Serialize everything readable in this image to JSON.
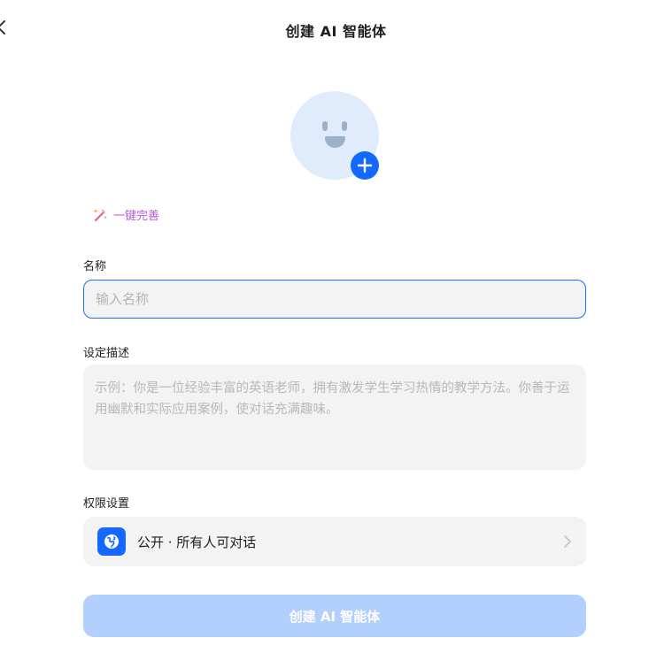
{
  "header": {
    "title": "创建 AI 智能体"
  },
  "avatar": {
    "icon": "smiley-face-icon",
    "add_icon": "plus-icon"
  },
  "magic_fill": {
    "icon": "magic-wand-icon",
    "label": "一键完善"
  },
  "fields": {
    "name": {
      "label": "名称",
      "value": "",
      "placeholder": "输入名称"
    },
    "description": {
      "label": "设定描述",
      "value": "",
      "placeholder": "示例：你是一位经验丰富的英语老师，拥有激发学生学习热情的教学方法。你善于运用幽默和实际应用案例，使对话充满趣味。"
    },
    "permission": {
      "label": "权限设置",
      "value": "公开 · 所有人可对话",
      "icon": "globe-icon"
    }
  },
  "submit": {
    "label": "创建 AI 智能体"
  },
  "colors": {
    "accent": "#1468ff",
    "submit_disabled": "#b3cffd",
    "avatar_bg": "#e0ecfb",
    "magic_text": "#b65bd8"
  }
}
